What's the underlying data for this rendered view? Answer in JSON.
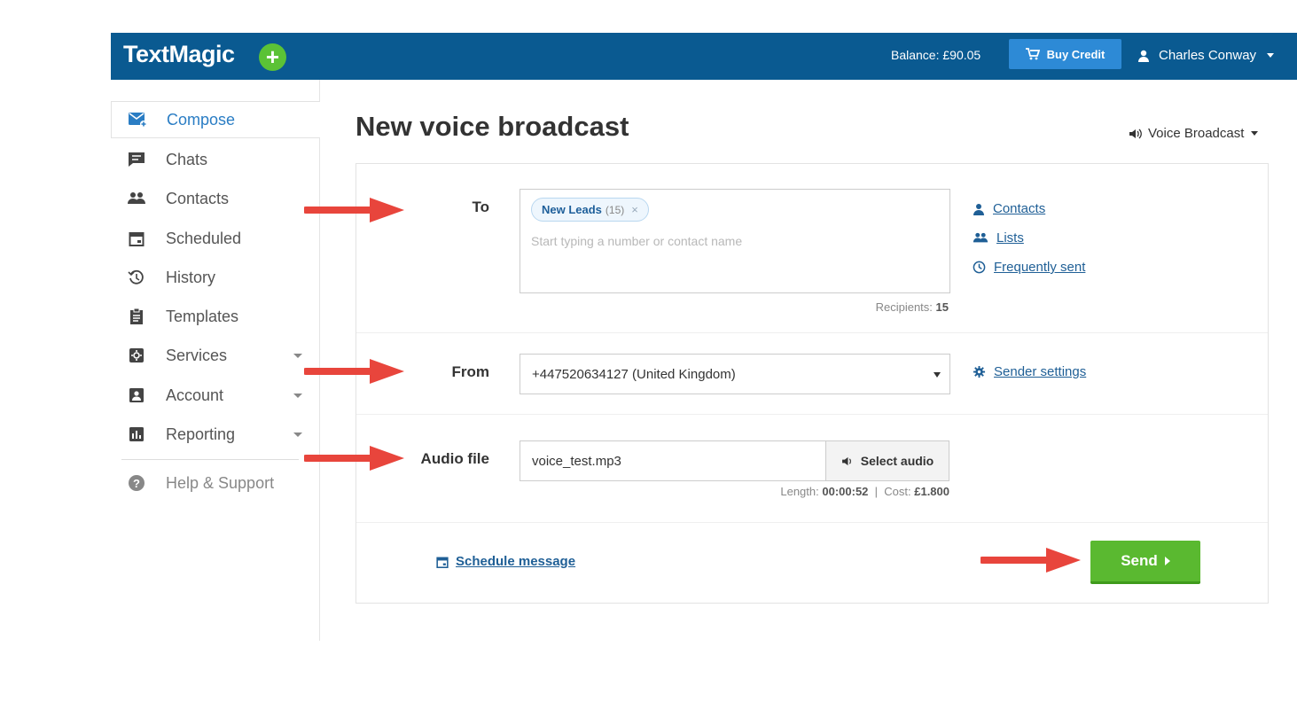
{
  "header": {
    "logo": "TextMagic",
    "logo_plus": "+",
    "balance": "Balance: £90.05",
    "buy_credit": "Buy Credit",
    "user_name": "Charles Conway"
  },
  "sidebar": {
    "items": [
      {
        "label": "Compose",
        "icon": "compose-icon"
      },
      {
        "label": "Chats",
        "icon": "chat-icon"
      },
      {
        "label": "Contacts",
        "icon": "contacts-icon"
      },
      {
        "label": "Scheduled",
        "icon": "calendar-icon"
      },
      {
        "label": "History",
        "icon": "history-icon"
      },
      {
        "label": "Templates",
        "icon": "clipboard-icon"
      },
      {
        "label": "Services",
        "icon": "services-icon"
      },
      {
        "label": "Account",
        "icon": "account-icon"
      },
      {
        "label": "Reporting",
        "icon": "chart-icon"
      },
      {
        "label": "Help & Support",
        "icon": "help-icon"
      }
    ]
  },
  "main": {
    "title": "New voice broadcast",
    "mode": "Voice Broadcast",
    "to": {
      "label": "To",
      "chip_name": "New Leads",
      "chip_count": "(15)",
      "chip_remove": "×",
      "placeholder": "Start typing a number or contact name",
      "recipients_label": "Recipients:",
      "recipients_count": "15"
    },
    "links": {
      "contacts": "Contacts",
      "lists": "Lists",
      "frequently_sent": "Frequently sent",
      "sender_settings": "Sender settings"
    },
    "from": {
      "label": "From",
      "selected": "+447520634127 (United Kingdom)"
    },
    "audio": {
      "label": "Audio file",
      "value": "voice_test.mp3",
      "select_button": "Select audio",
      "length_label": "Length:",
      "length_value": "00:00:52",
      "separator": "|",
      "cost_label": "Cost:",
      "cost_value": "£1.800"
    },
    "schedule": "Schedule message",
    "send": "Send"
  },
  "colors": {
    "header_bg": "#0a5a91",
    "accent": "#2a7dc4",
    "send_green": "#5ab930",
    "annotation_arrow": "#e8453c"
  }
}
